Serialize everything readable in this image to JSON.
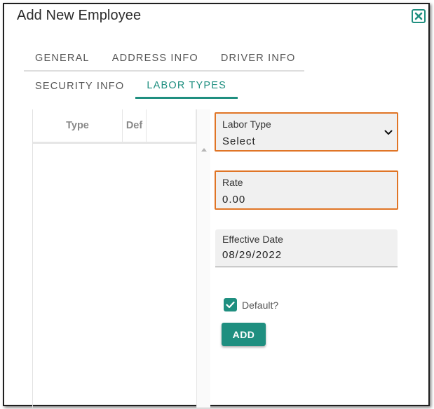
{
  "dialog": {
    "title": "Add New Employee",
    "close_icon": "close-x-icon"
  },
  "tabs": {
    "row1": [
      {
        "label": "GENERAL",
        "active": false
      },
      {
        "label": "ADDRESS INFO",
        "active": false
      },
      {
        "label": "DRIVER INFO",
        "active": false
      }
    ],
    "row2": [
      {
        "label": "SECURITY INFO",
        "active": false
      },
      {
        "label": "LABOR TYPES",
        "active": true
      }
    ]
  },
  "grid": {
    "columns": [
      "Type",
      "Def",
      ""
    ],
    "rows": [],
    "scroll_icon": "scroll-up-arrow-icon"
  },
  "form": {
    "labor_type": {
      "label": "Labor Type",
      "value": "Select",
      "icon": "chevron-down-icon"
    },
    "rate": {
      "label": "Rate",
      "value": "0.00"
    },
    "effective_date": {
      "label": "Effective Date",
      "value": "08/29/2022"
    },
    "default": {
      "label": "Default?",
      "checked": true
    },
    "add_label": "ADD"
  },
  "colors": {
    "accent": "#1f8f80",
    "highlight_border": "#e07526"
  }
}
